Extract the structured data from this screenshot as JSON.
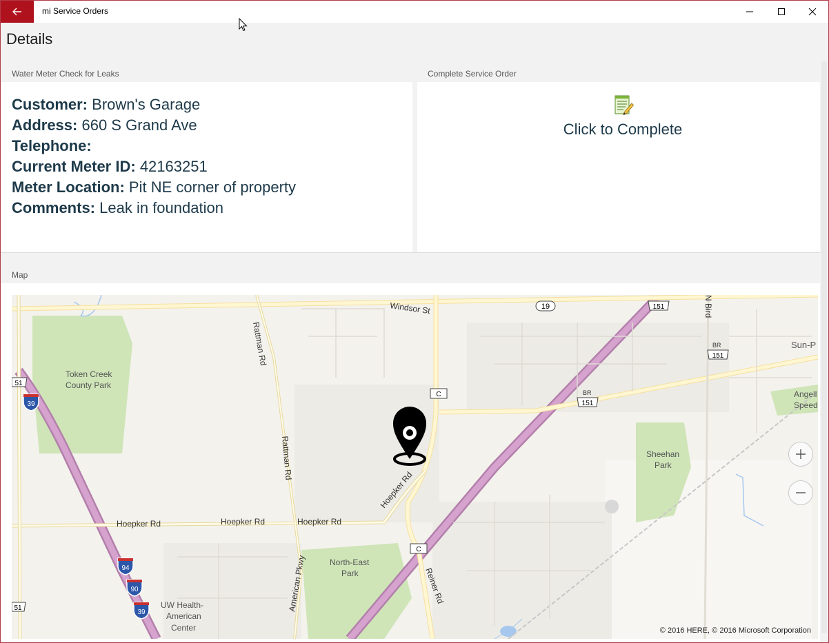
{
  "window": {
    "title": "mi Service Orders"
  },
  "page": {
    "title": "Details"
  },
  "sections": {
    "order": {
      "header": "Water Meter Check for Leaks"
    },
    "complete": {
      "header": "Complete Service Order",
      "label": "Click to Complete"
    },
    "map": {
      "header": "Map"
    }
  },
  "details": {
    "customer": {
      "label": "Customer:",
      "value": "Brown's Garage"
    },
    "address": {
      "label": "Address:",
      "value": "660 S Grand Ave"
    },
    "telephone": {
      "label": "Telephone:",
      "value": ""
    },
    "meter_id": {
      "label": "Current Meter ID:",
      "value": "42163251"
    },
    "meter_location": {
      "label": "Meter Location:",
      "value": "Pit NE corner of property"
    },
    "comments": {
      "label": "Comments:",
      "value": "Leak in foundation"
    }
  },
  "map": {
    "labels": {
      "windsor": "Windsor St",
      "rattman1": "Rattman Rd",
      "rattman2": "Rattman Rd",
      "token_creek1": "Token Creek",
      "token_creek2": "County Park",
      "hoepker1": "Hoepker Rd",
      "hoepker2": "Hoepker Rd",
      "hoepker3": "Hoepker Rd",
      "hoepker4": "Hoepker Rd",
      "american_pkwy": "American Pkwy",
      "northeast1": "North-East",
      "northeast2": "Park",
      "uw1": "UW Health-",
      "uw2": "American",
      "uw3": "Center",
      "reiner": "Reiner Rd",
      "sheehan1": "Sheehan",
      "sheehan2": "Park",
      "sunp": "Sun-P",
      "angell1": "Angell",
      "angell2": "Speed",
      "nbird": "N Bird",
      "br1": "BR",
      "br2": "BR"
    },
    "shields": {
      "hwy19": "19",
      "us151a": "151",
      "us151b": "151",
      "us151c": "151",
      "us51a": "51",
      "us51b": "51",
      "i39a": "39",
      "i39b": "39",
      "i94": "94",
      "i90": "90",
      "cC1": "C",
      "cC2": "C"
    },
    "copyright": "© 2016 HERE, © 2016 Microsoft Corporation",
    "colors": {
      "park": "#cfe5b8",
      "highway": "#c98fc0",
      "road": "#fff3c4",
      "water": "#a6c8ef"
    }
  },
  "colors": {
    "accent": "#b0121d",
    "text": "#1e3a4a"
  }
}
